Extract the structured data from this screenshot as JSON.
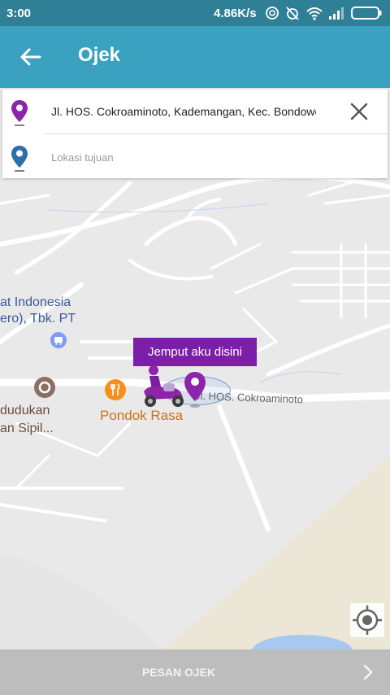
{
  "status_bar": {
    "time": "3:00",
    "network_speed": "4.86K/s"
  },
  "app_bar": {
    "title": "Ojek"
  },
  "search": {
    "pickup_value": "Jl. HOS. Cokroaminoto, Kademangan, Kec. Bondowoso",
    "destination_placeholder": "Lokasi tujuan"
  },
  "map": {
    "labels": {
      "indonesia_line1": "at Indonesia",
      "indonesia_line2": "ero), Tbk. PT",
      "kependudukan_line1": "dudukan",
      "kependudukan_line2": "an Sipil...",
      "pondok_rasa": "Pondok Rasa",
      "street": "Jl. HOS. Cokroaminoto"
    },
    "pickup_tooltip": "Jemput aku disini"
  },
  "bottom_bar": {
    "order_label": "PESAN OJEK"
  },
  "colors": {
    "accent": "#3aa1c0",
    "brand_purple": "#7c1fa8",
    "status_bar": "#2f7f96"
  }
}
